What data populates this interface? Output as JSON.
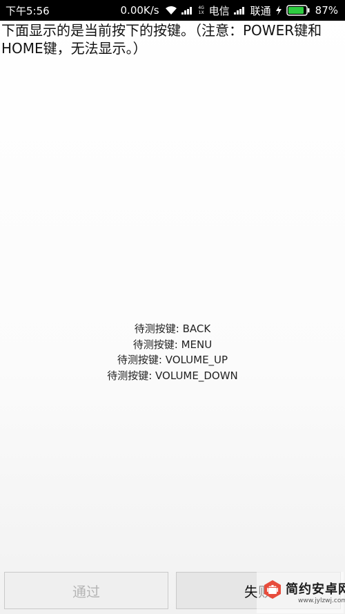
{
  "status_bar": {
    "time": "下午5:56",
    "net_speed": "0.00K/s",
    "sim_tag_top": "4G",
    "sim_tag_bottom": "1X",
    "carrier1": "电信",
    "carrier2": "联通",
    "battery": "87%"
  },
  "instruction": "下面显示的是当前按下的按键。（注意：POWER键和HOME键，无法显示。）",
  "pending_keys": [
    "待测按键: BACK",
    "待测按键: MENU",
    "待测按键: VOLUME_UP",
    "待测按键: VOLUME_DOWN"
  ],
  "buttons": {
    "pass_label": "通过",
    "fail_label": "失败"
  },
  "watermark": {
    "title": "简约安卓网",
    "url": "www.jylzwj.com"
  }
}
